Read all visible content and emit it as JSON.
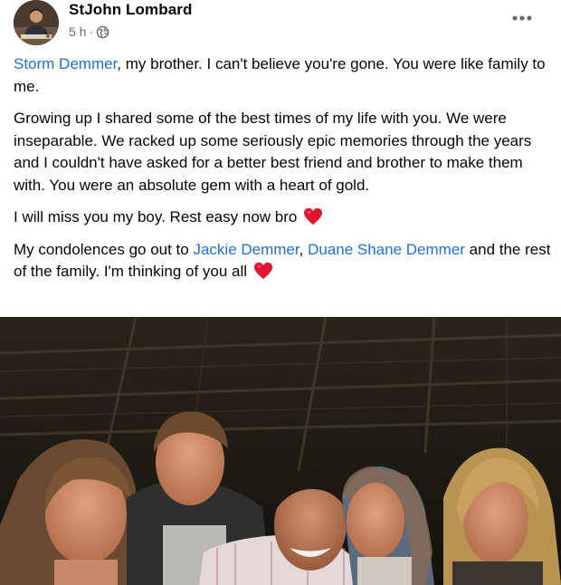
{
  "post": {
    "author": "StJohn Lombard",
    "time": "5 h",
    "separator": "·",
    "privacy_icon": "globe-icon",
    "more_icon": "more-options-icon"
  },
  "body": {
    "p1": {
      "mention": "Storm Demmer",
      "text": ", my brother. I can't believe you're gone. You were like family to me."
    },
    "p2": "Growing up I shared some of the best times of my life with you. We were inseparable. We racked up some seriously epic memories through the years and I couldn't have asked for a better best friend and brother to make them with. You were an absolute gem with a heart of gold.",
    "p3": "I will miss you my boy. Rest easy now bro",
    "p4": {
      "before": "My condolences go out to ",
      "mention1": "Jackie Demmer",
      "sep": ", ",
      "mention2": "Duane Shane Demmer",
      "after": " and the rest of the family. I'm thinking of you all"
    },
    "emoji": "heart-emoji"
  },
  "colors": {
    "mention": "#216fdb",
    "meta": "#65676b",
    "heart": "#e0152e"
  }
}
